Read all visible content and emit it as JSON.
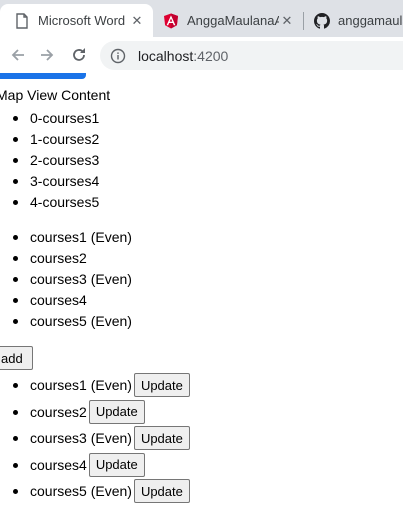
{
  "browser": {
    "tabs": [
      {
        "title": "Microsoft Word",
        "icon": "document-icon",
        "active": true
      },
      {
        "title": "AnggaMaulanaA",
        "icon": "angular-icon",
        "active": false
      },
      {
        "title": "anggamaula",
        "icon": "github-icon",
        "active": false
      }
    ],
    "url": {
      "host": "localhost",
      "port": ":4200"
    }
  },
  "page": {
    "map_title": "Map View Content",
    "indexed_courses": [
      "0-courses1",
      "1-courses2",
      "2-courses3",
      "3-courses4",
      "4-courses5"
    ],
    "parity_courses": [
      "courses1 (Even)",
      "courses2",
      "courses3 (Even)",
      "courses4",
      "courses5 (Even)"
    ],
    "add_label": "add",
    "update_label": "Update",
    "update_courses": [
      "courses1 (Even)",
      "courses2",
      "courses3 (Even)",
      "courses4",
      "courses5 (Even)"
    ]
  },
  "colors": {
    "tabstrip": "#dee1e6",
    "omnibox": "#f1f3f4",
    "primary_button": "#1a73e8",
    "angular": "#dd0031"
  }
}
